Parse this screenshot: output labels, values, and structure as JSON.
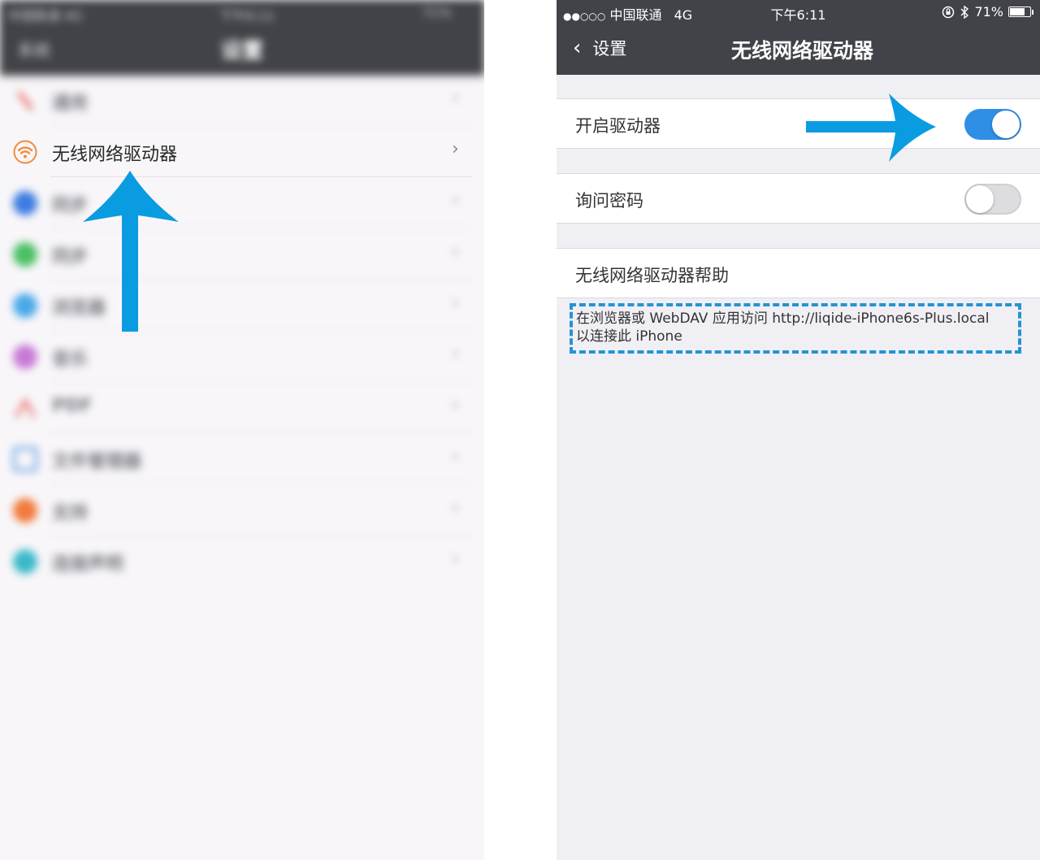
{
  "left": {
    "status_bar": {
      "carrier": "中国联通 4G",
      "time": "下午6:11",
      "battery": "71%"
    },
    "nav": {
      "back_label": "系统",
      "title": "设置"
    },
    "items": [
      {
        "label": "通用",
        "icon": "wrench-icon",
        "color": "#e86a5e"
      },
      {
        "label": "无线网络驱动器",
        "icon": "wifi-icon",
        "color": "#f08c3a"
      },
      {
        "label": "同步",
        "icon": "sync-icon",
        "color": "#3c7be0"
      },
      {
        "label": "同步",
        "icon": "recycle-icon",
        "color": "#4bbf63"
      },
      {
        "label": "浏览器",
        "icon": "compass-icon",
        "color": "#4aa8e8"
      },
      {
        "label": "音乐",
        "icon": "music-icon",
        "color": "#c77ad6"
      },
      {
        "label": "PDF",
        "icon": "pdf-icon",
        "color": "#e2483e"
      },
      {
        "label": "文件管理器",
        "icon": "folder-icon",
        "color": "#4a8fe0"
      },
      {
        "label": "支持",
        "icon": "heart-icon",
        "color": "#f07a3c"
      },
      {
        "label": "连接声明",
        "icon": "bulb-icon",
        "color": "#3ab8c8"
      }
    ],
    "chevron": "›"
  },
  "right": {
    "status_bar": {
      "signal": "●●○○○",
      "carrier": "中国联通",
      "network": "4G",
      "time": "下午6:11",
      "battery": "71%",
      "battery_level": 0.71
    },
    "nav": {
      "back_label": "设置",
      "title": "无线网络驱动器"
    },
    "cells": {
      "enable_driver": {
        "label": "开启驱动器",
        "on": true
      },
      "ask_password": {
        "label": "询问密码",
        "on": false
      },
      "help": {
        "label": "无线网络驱动器帮助"
      }
    },
    "help_text": {
      "line1": "在浏览器或 WebDAV 应用访问 http://liqide-iPhone6s-Plus.local",
      "line2": "以连接此 iPhone"
    }
  },
  "colors": {
    "arrow": "#0a9ce0",
    "toggle_on": "#2f8fe6",
    "nav_bg": "#414348",
    "dashed_box": "#2593d3"
  }
}
